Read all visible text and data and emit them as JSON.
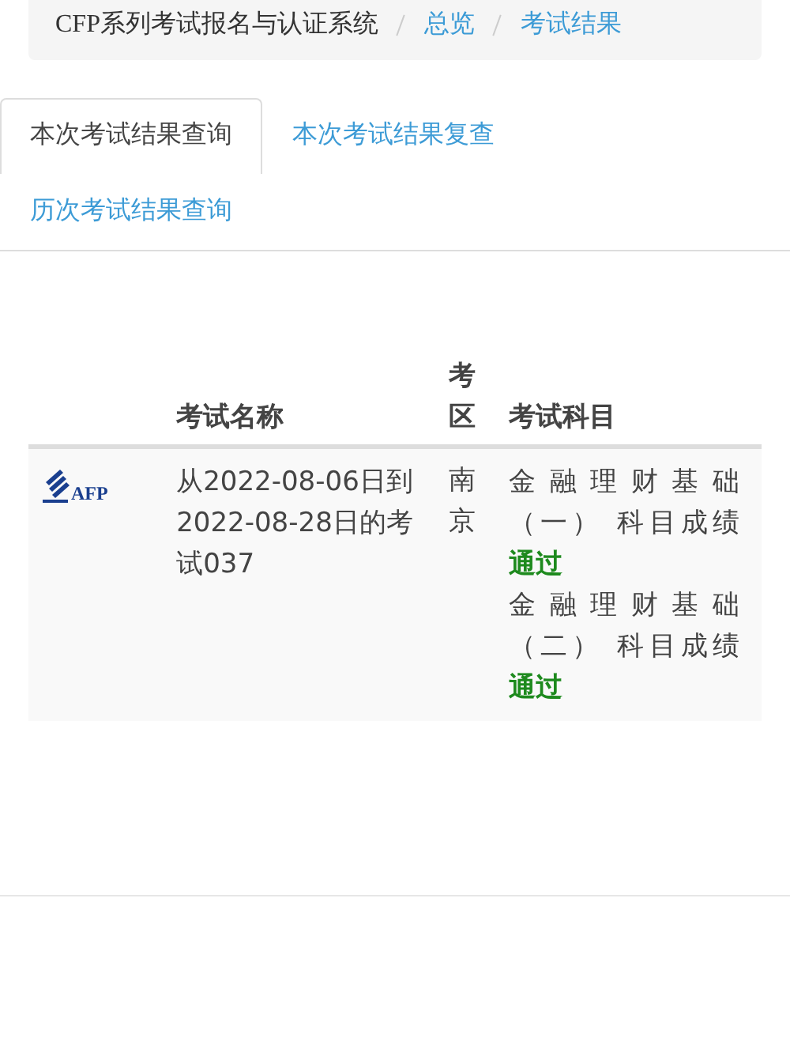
{
  "breadcrumb": [
    {
      "label": "CFP系列考试报名与认证系统",
      "kind": "text"
    },
    {
      "label": "总览",
      "kind": "link"
    },
    {
      "label": "考试结果",
      "kind": "link"
    }
  ],
  "tabs": [
    {
      "label": "本次考试结果查询",
      "selected": true
    },
    {
      "label": "本次考试结果复查",
      "selected": false
    },
    {
      "label": "历次考试结果查询",
      "selected": false
    }
  ],
  "table": {
    "columns": [
      "考试名称",
      "考区",
      "考试科目"
    ],
    "rows": [
      {
        "logo": "AFP",
        "exam_name": "从2022-08-06日到2022-08-28日的考试037",
        "district": "南京",
        "subjects": [
          {
            "name": "金融理财基础（一）",
            "label": "科目成绩",
            "result": "通过"
          },
          {
            "name": "金融理财基础（二）",
            "label": "科目成绩",
            "result": "通过"
          }
        ]
      }
    ]
  }
}
